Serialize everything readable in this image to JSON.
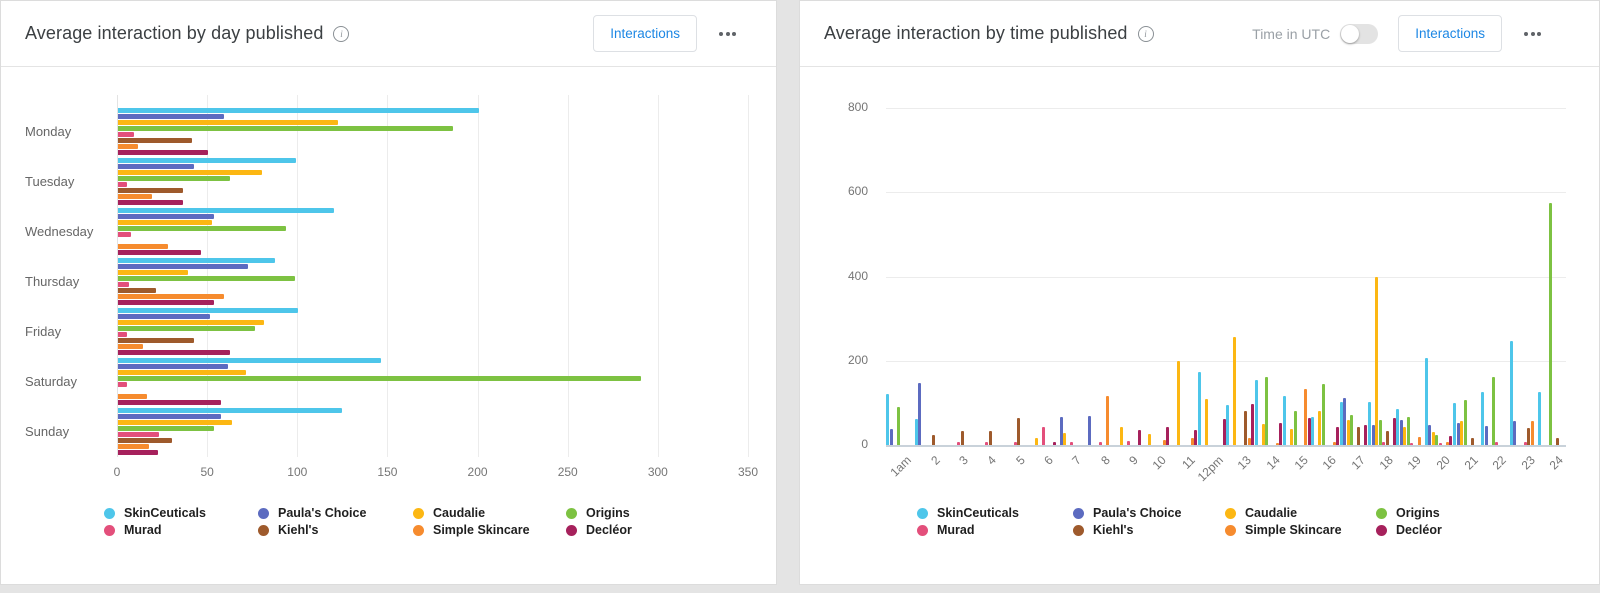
{
  "panels": {
    "left": {
      "title": "Average interaction by day published",
      "interactions_button": "Interactions"
    },
    "right": {
      "title": "Average interaction by time published",
      "utc_label": "Time in UTC",
      "utc_toggle_on": false,
      "interactions_button": "Interactions"
    }
  },
  "icons": {
    "info": "i"
  },
  "colors": {
    "accent_blue": "#1d87e4",
    "grid": "#ececec",
    "axis_text": "#757575"
  },
  "chart_data": [
    {
      "type": "bar",
      "orientation": "horizontal",
      "title": "Average interaction by day published",
      "xlabel": "",
      "ylabel": "",
      "xlim": [
        0,
        350
      ],
      "xticks": [
        0,
        50,
        100,
        150,
        200,
        250,
        300,
        350
      ],
      "grid": true,
      "legend_position": "bottom",
      "categories": [
        "Monday",
        "Tuesday",
        "Wednesday",
        "Thursday",
        "Friday",
        "Saturday",
        "Sunday"
      ],
      "series": [
        {
          "name": "SkinCeuticals",
          "color": "#4ec6ea",
          "values": [
            200,
            99,
            120,
            87,
            100,
            146,
            124
          ]
        },
        {
          "name": "Paula's Choice",
          "color": "#5c6bc0",
          "values": [
            59,
            42,
            53,
            72,
            51,
            61,
            57
          ]
        },
        {
          "name": "Caudalie",
          "color": "#fcb713",
          "values": [
            122,
            80,
            52,
            39,
            81,
            71,
            63
          ]
        },
        {
          "name": "Origins",
          "color": "#7dc242",
          "values": [
            186,
            62,
            93,
            98,
            76,
            290,
            53
          ]
        },
        {
          "name": "Murad",
          "color": "#e34f7b",
          "values": [
            9,
            5,
            7,
            6,
            5,
            5,
            23
          ]
        },
        {
          "name": "Kiehl's",
          "color": "#9e5a2c",
          "values": [
            41,
            36,
            0,
            21,
            42,
            0,
            30
          ]
        },
        {
          "name": "Simple Skincare",
          "color": "#f68b2e",
          "values": [
            11,
            19,
            28,
            59,
            14,
            16,
            17
          ]
        },
        {
          "name": "Decléor",
          "color": "#a6215c",
          "values": [
            50,
            36,
            46,
            53,
            62,
            57,
            22
          ]
        }
      ]
    },
    {
      "type": "bar",
      "orientation": "vertical",
      "title": "Average interaction by time published",
      "xlabel": "",
      "ylabel": "",
      "ylim": [
        0,
        800
      ],
      "yticks": [
        0,
        200,
        400,
        600,
        800
      ],
      "grid": true,
      "legend_position": "bottom",
      "categories": [
        "1am",
        "2",
        "3",
        "4",
        "5",
        "6",
        "7",
        "8",
        "9",
        "10",
        "11",
        "12pm",
        "13",
        "14",
        "15",
        "16",
        "17",
        "18",
        "19",
        "20",
        "21",
        "22",
        "23",
        "24"
      ],
      "series": [
        {
          "name": "SkinCeuticals",
          "color": "#4ec6ea",
          "values": [
            120,
            61,
            0,
            0,
            0,
            0,
            0,
            0,
            0,
            0,
            0,
            174,
            96,
            155,
            117,
            67,
            101,
            102,
            86,
            207,
            100,
            127,
            246,
            127
          ]
        },
        {
          "name": "Paula's Choice",
          "color": "#5c6bc0",
          "values": [
            37,
            148,
            0,
            0,
            0,
            0,
            67,
            69,
            0,
            0,
            0,
            0,
            0,
            0,
            0,
            0,
            112,
            47,
            60,
            47,
            52,
            46,
            58,
            0
          ]
        },
        {
          "name": "Caudalie",
          "color": "#fcb713",
          "values": [
            0,
            0,
            0,
            0,
            0,
            16,
            29,
            0,
            43,
            26,
            200,
            110,
            257,
            50,
            37,
            80,
            60,
            400,
            43,
            32,
            56,
            0,
            0,
            0
          ]
        },
        {
          "name": "Origins",
          "color": "#7dc242",
          "values": [
            90,
            0,
            0,
            0,
            0,
            0,
            0,
            0,
            0,
            0,
            0,
            0,
            0,
            161,
            81,
            144,
            71,
            59,
            67,
            24,
            107,
            162,
            0,
            575
          ]
        },
        {
          "name": "Murad",
          "color": "#e34f7b",
          "values": [
            0,
            0,
            6,
            6,
            6,
            43,
            6,
            6,
            10,
            0,
            0,
            0,
            0,
            0,
            0,
            0,
            0,
            8,
            5,
            5,
            0,
            6,
            7,
            0
          ]
        },
        {
          "name": "Kiehl's",
          "color": "#9e5a2c",
          "values": [
            0,
            23,
            34,
            34,
            65,
            0,
            0,
            0,
            0,
            0,
            0,
            0,
            80,
            0,
            0,
            0,
            43,
            34,
            0,
            0,
            17,
            0,
            40,
            17
          ]
        },
        {
          "name": "Simple Skincare",
          "color": "#f68b2e",
          "values": [
            0,
            0,
            0,
            0,
            0,
            0,
            0,
            116,
            0,
            13,
            17,
            0,
            17,
            5,
            133,
            8,
            0,
            0,
            20,
            8,
            0,
            0,
            58,
            0
          ]
        },
        {
          "name": "Decléor",
          "color": "#a6215c",
          "values": [
            0,
            0,
            0,
            0,
            0,
            6,
            0,
            0,
            36,
            42,
            35,
            61,
            98,
            53,
            63,
            42,
            47,
            64,
            0,
            22,
            0,
            0,
            0,
            0
          ]
        }
      ]
    }
  ]
}
